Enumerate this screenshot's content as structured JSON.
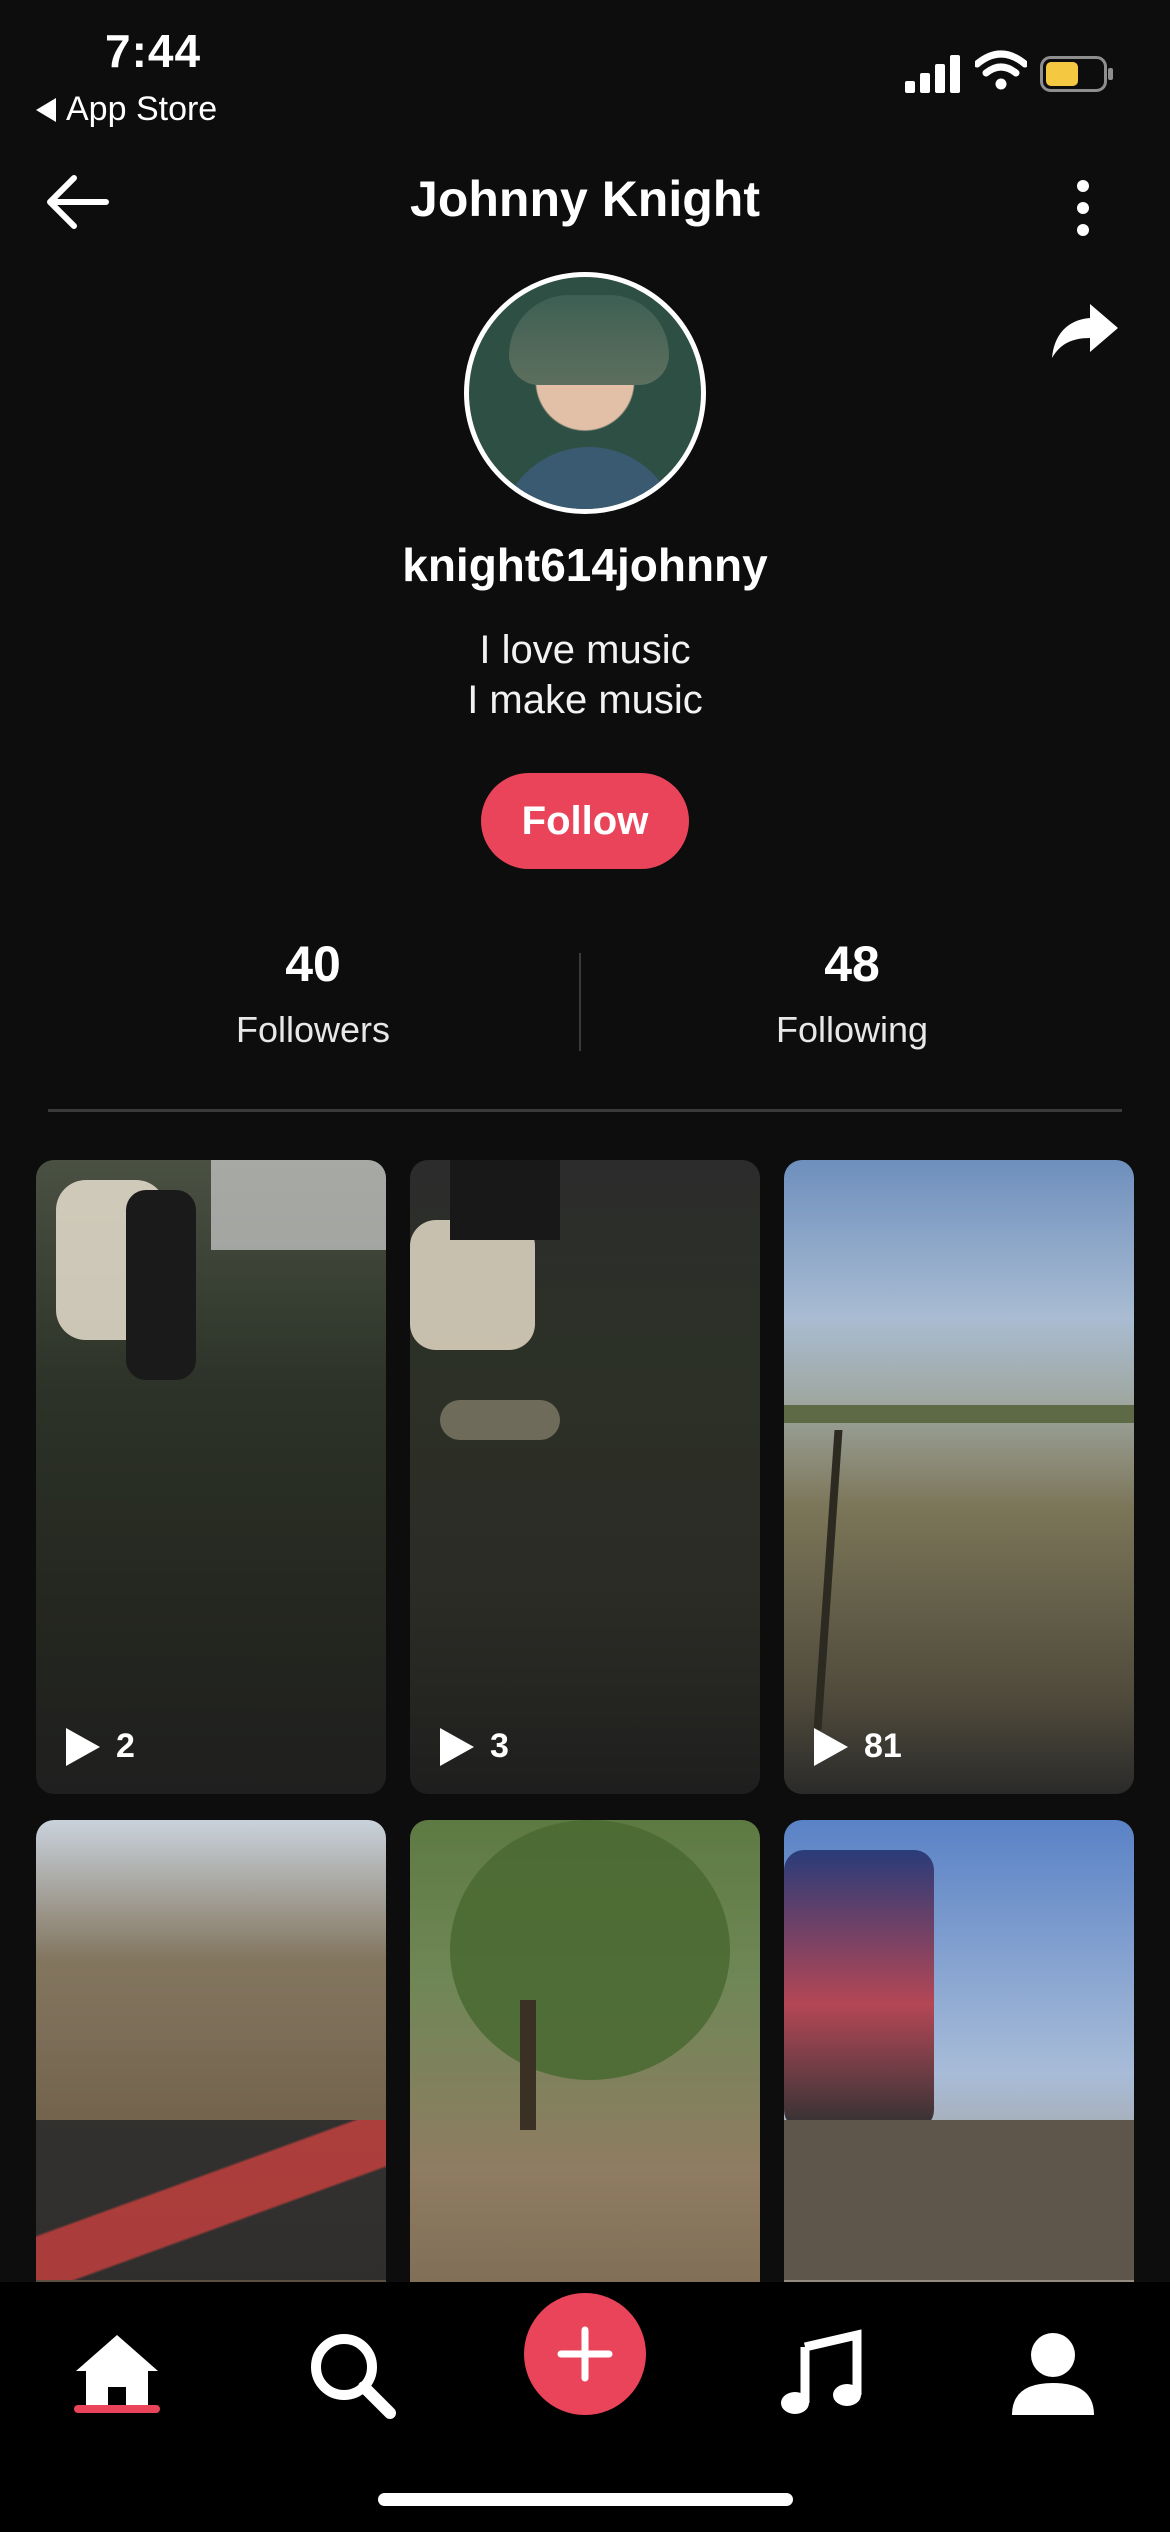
{
  "status_bar": {
    "time": "7:44",
    "back_app": "App Store"
  },
  "header": {
    "title": "Johnny Knight"
  },
  "profile": {
    "username": "knight614johnny",
    "bio_line1": "I love music",
    "bio_line2": "I make music",
    "follow_label": "Follow"
  },
  "stats": [
    {
      "value": "40",
      "label": "Followers"
    },
    {
      "value": "48",
      "label": "Following"
    }
  ],
  "videos": [
    {
      "plays": "2"
    },
    {
      "plays": "3"
    },
    {
      "plays": "81"
    }
  ],
  "tabbar": {
    "icons": [
      "home-icon",
      "search-icon",
      "add-icon",
      "music-note-icon",
      "profile-icon"
    ],
    "active": "home-icon"
  },
  "colors": {
    "accent": "#ea445a",
    "background": "#0d0d0e"
  }
}
